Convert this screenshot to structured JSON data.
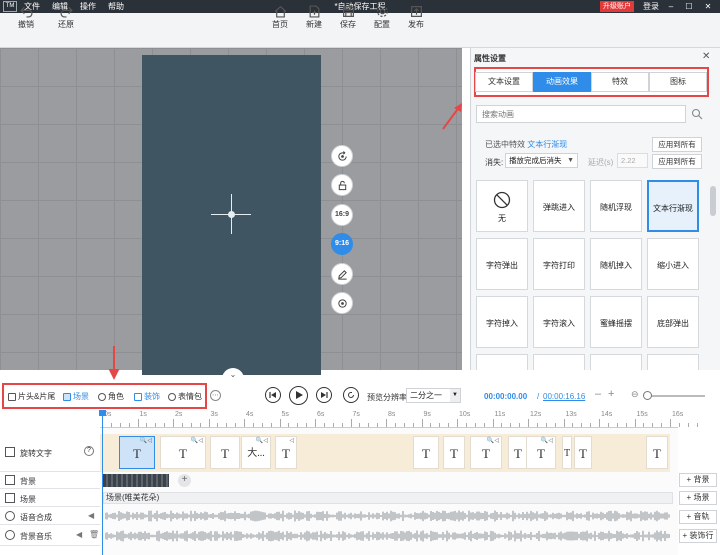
{
  "titlebar": {
    "logo": "TM",
    "menu": [
      "文件",
      "编辑",
      "操作",
      "帮助"
    ],
    "title": "*自动保存工程",
    "upgrade": "升级账户",
    "login": "登录"
  },
  "toolbar": {
    "undo": "撤销",
    "redo": "还原",
    "home": "首页",
    "new": "新建",
    "save": "保存",
    "config": "配置",
    "publish": "发布"
  },
  "canvas": {
    "ratio_169": "16:9",
    "ratio_916": "9:16"
  },
  "panel": {
    "title": "属性设置",
    "tabs": [
      "文本设置",
      "动画效果",
      "特效",
      "图标"
    ],
    "active_tab": 1,
    "search_placeholder": "搜索动画",
    "selected_label": "已选中特效",
    "selected_value": "文本行渐现",
    "apply_all": "应用到所有",
    "disappear_label": "消失:",
    "disappear_value": "播放完成后消失",
    "duration_label": "延迟(s)",
    "duration_value": "2.22",
    "effects": [
      "无",
      "弹跳进入",
      "随机浮现",
      "文本行渐现",
      "字符弹出",
      "字符打印",
      "随机掉入",
      "缩小进入",
      "字符掉入",
      "字符滚入",
      "蜜蜂摇摆",
      "底部弹出"
    ],
    "selected_effect": 3
  },
  "assets": {
    "items": [
      "片头&片尾",
      "场景",
      "角色",
      "装饰",
      "表情包"
    ],
    "active": 1
  },
  "playback": {
    "preview_label": "预览分辨率",
    "preview_value": "二分之一",
    "time_current": "00:00:00.00",
    "time_sep": "/",
    "time_total": "00:00:16.16"
  },
  "ruler": [
    "0s",
    "1s",
    "2s",
    "3s",
    "4s",
    "5s",
    "6s",
    "7s",
    "8s",
    "9s",
    "10s",
    "11s",
    "12s",
    "13s",
    "14s",
    "15s",
    "16s"
  ],
  "tracks": {
    "text_track": "旋转文字",
    "background": "背景",
    "scene": "场景",
    "voice": "语音合成",
    "music": "背景音乐"
  },
  "clips": {
    "text_glyph": "T",
    "text_big": "大...",
    "scene_name": "场景(唯美花朵)"
  },
  "add_buttons": {
    "background": "+ 背景",
    "scene": "+ 场景",
    "voice": "+ 音轨",
    "music": "+ 装饰行"
  }
}
